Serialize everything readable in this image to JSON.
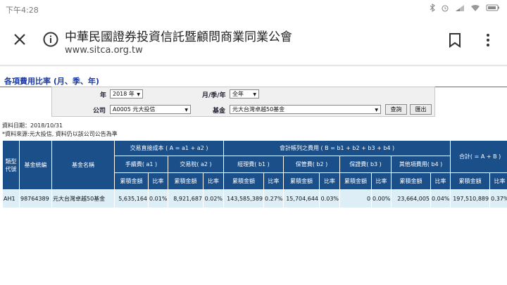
{
  "status": {
    "time": "下午4:28"
  },
  "browser": {
    "title": "中華民國證券投資信託暨顧問商業同業公會",
    "url": "www.sitca.org.tw"
  },
  "page": {
    "title": "各項費用比率 (月、季、年)"
  },
  "filters": {
    "year_label": "年",
    "year_value": "2018 年",
    "period_label": "月/季/年",
    "period_value": "全年",
    "company_label": "公司",
    "company_value": "A0005 元大投信",
    "fund_label": "基金",
    "fund_value": "元大台灣卓越50基金",
    "query_button": "查詢",
    "export_button": "匯出"
  },
  "meta": {
    "date": "資料日期：2018/10/31",
    "source": "*資料來源:元大投信, 資料仍以該公司公告為準"
  },
  "table": {
    "h_type": "類型代號",
    "h_code": "基金統編",
    "h_name": "基金名稱",
    "h_trade": "交易直接成本 ( A = a1 + a2 )",
    "h_account": "會計帳列之費用 ( B = b1 + b2 + b3 + b4 )",
    "h_total": "合計( = A + B )",
    "h_fee": "手續費( a1 )",
    "h_tax": "交易稅( a2 )",
    "h_mgr": "經理費( b1 )",
    "h_custody": "保管費( b2 )",
    "h_guarantee": "保證費( b3 )",
    "h_other": "其他項費用( b4 )",
    "h_amount": "累積金額",
    "h_ratio": "比率",
    "row": {
      "type": "AH1",
      "code": "98764389",
      "name": "元大台灣卓越50基金",
      "fee_amt": "5,635,164",
      "fee_ratio": "0.01%",
      "tax_amt": "8,921,687",
      "tax_ratio": "0.02%",
      "mgr_amt": "143,585,389",
      "mgr_ratio": "0.27%",
      "custody_amt": "15,704,644",
      "custody_ratio": "0.03%",
      "guarantee_amt": "0",
      "guarantee_ratio": "0.00%",
      "other_amt": "23,664,005",
      "other_ratio": "0.04%",
      "total_amt": "197,510,889",
      "total_ratio": "0.37%"
    }
  }
}
